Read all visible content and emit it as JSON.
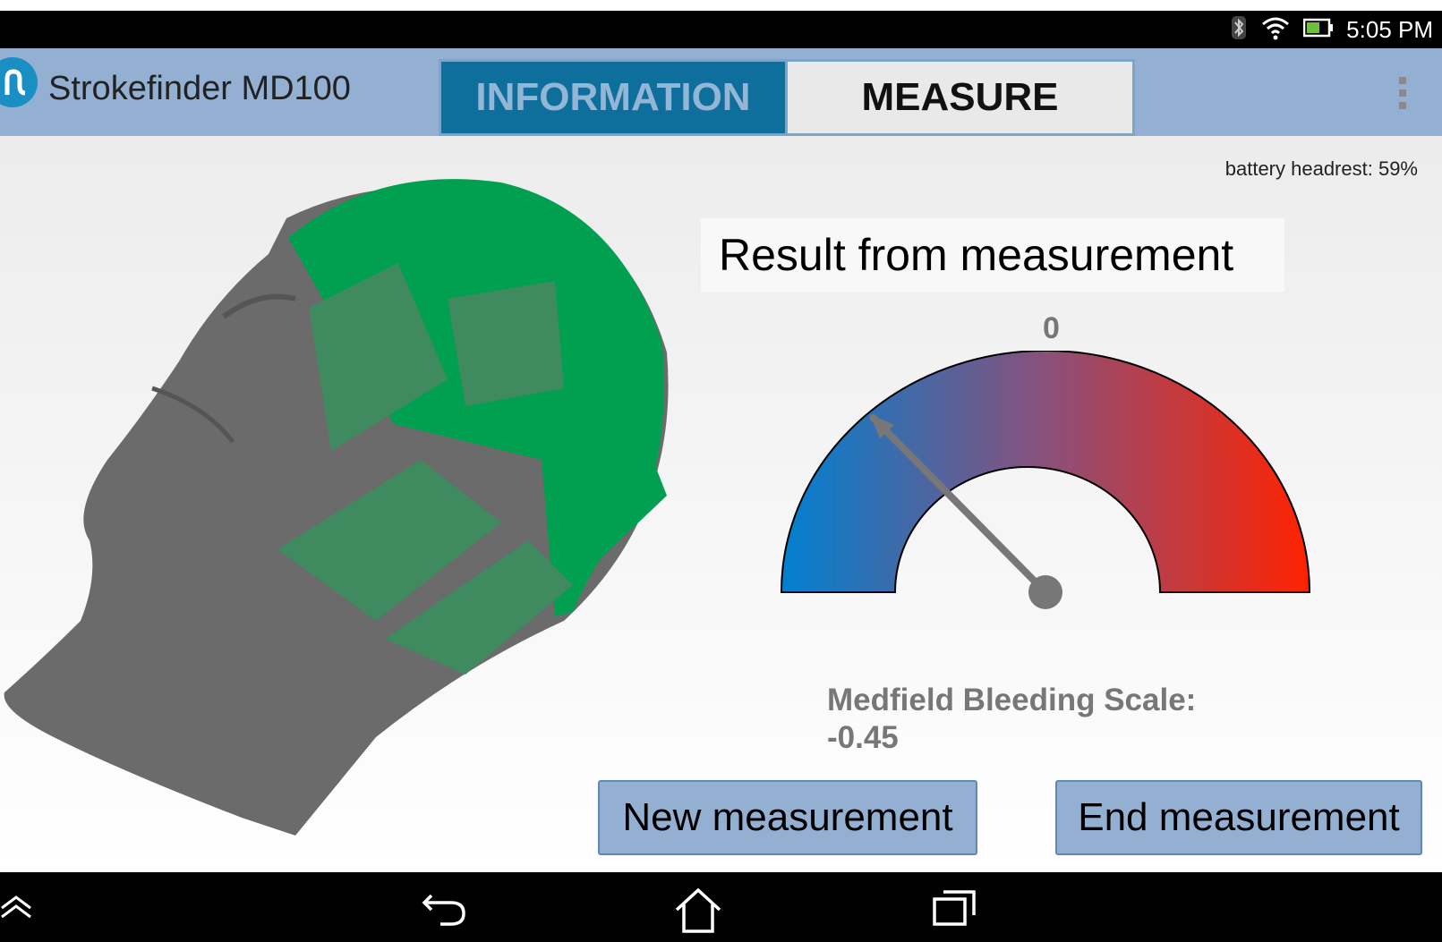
{
  "status_bar": {
    "time": "5:05 PM",
    "icons": [
      "bluetooth-icon",
      "wifi-icon",
      "battery-icon"
    ]
  },
  "app_bar": {
    "title": "Strokefinder MD100",
    "tabs": [
      {
        "label": "INFORMATION",
        "selected": false
      },
      {
        "label": "MEASURE",
        "selected": true
      }
    ],
    "colors": {
      "bar": "#93b0d3",
      "tab_inactive": "#0f6f9c"
    }
  },
  "main": {
    "battery_text": "battery headrest: 59%",
    "result_title": "Result from measurement",
    "gauge": {
      "top_label": "0",
      "value": -0.45,
      "colors": {
        "low": "#0080d0",
        "mid": "#8a507a",
        "high": "#ff2200"
      }
    },
    "scale_label": "Medfield Bleeding Scale:",
    "scale_value": "-0.45",
    "buttons": {
      "new": "New measurement",
      "end": "End measurement"
    }
  },
  "nav_bar": {
    "icons": [
      "collapse-icon",
      "back-icon",
      "home-icon",
      "recents-icon"
    ]
  }
}
